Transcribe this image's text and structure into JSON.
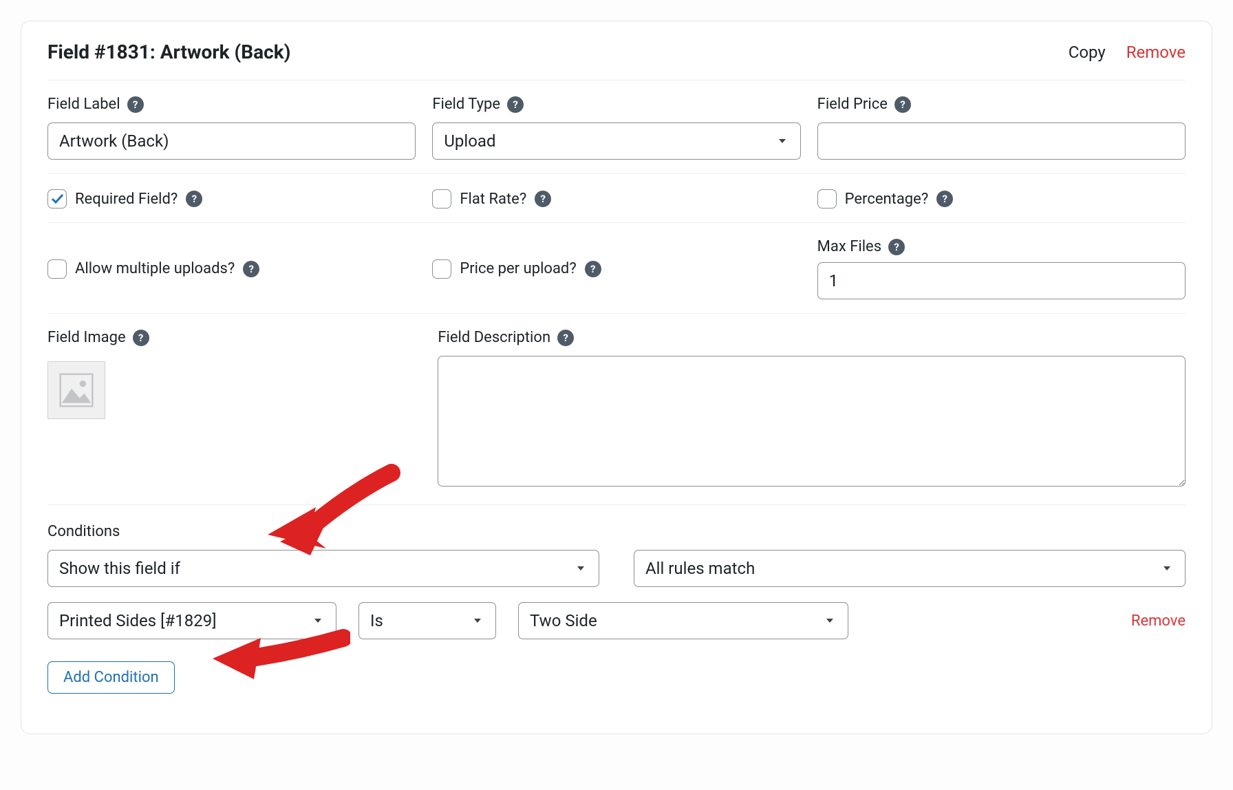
{
  "header": {
    "title": "Field #1831: Artwork (Back)",
    "copy": "Copy",
    "remove": "Remove"
  },
  "labels": {
    "field_label": "Field Label",
    "field_type": "Field Type",
    "field_price": "Field Price",
    "required": "Required Field?",
    "flat_rate": "Flat Rate?",
    "percentage": "Percentage?",
    "allow_multiple": "Allow multiple uploads?",
    "price_per_upload": "Price per upload?",
    "max_files": "Max Files",
    "field_image": "Field Image",
    "field_description": "Field Description",
    "conditions": "Conditions",
    "add_condition": "Add Condition"
  },
  "values": {
    "field_label": "Artwork (Back)",
    "field_type": "Upload",
    "field_price": "",
    "max_files": "1",
    "field_description": ""
  },
  "conditions": {
    "visibility": "Show this field if",
    "match": "All rules match",
    "rule_field": "Printed Sides [#1829]",
    "rule_op": "Is",
    "rule_value": "Two Side",
    "remove": "Remove"
  }
}
